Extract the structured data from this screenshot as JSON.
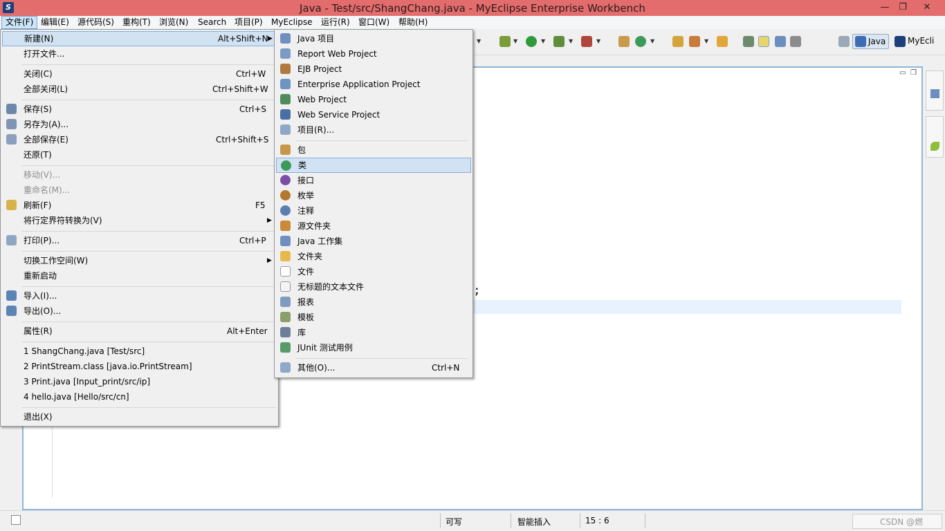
{
  "window": {
    "title": "Java  -  Test/src/ShangChang.java  -  MyEclipse Enterprise Workbench",
    "app_icon": "S",
    "min_glyph": "—",
    "max_glyph": "❐",
    "close_glyph": "✕"
  },
  "menubar": {
    "items": [
      "文件(F)",
      "编辑(E)",
      "源代码(S)",
      "重构(T)",
      "浏览(N)",
      "Search",
      "项目(P)",
      "MyEclipse",
      "运行(R)",
      "窗口(W)",
      "帮助(H)"
    ]
  },
  "toolbar": {
    "perspectives": [
      "Java",
      "MyEcli"
    ]
  },
  "editor": {
    "visible_code": ");"
  },
  "statusbar": {
    "writable": "可写",
    "insert_mode": "智能插入",
    "position": "15 : 6",
    "watermark": "CSDN @燃"
  },
  "file_menu": {
    "items": [
      {
        "label": "新建(N)",
        "shortcut": "Alt+Shift+N",
        "submenu": true
      },
      {
        "label": "打开文件..."
      },
      {
        "label": "关闭(C)",
        "shortcut": "Ctrl+W"
      },
      {
        "label": "全部关闭(L)",
        "shortcut": "Ctrl+Shift+W"
      },
      {
        "label": "保存(S)",
        "shortcut": "Ctrl+S"
      },
      {
        "label": "另存为(A)..."
      },
      {
        "label": "全部保存(E)",
        "shortcut": "Ctrl+Shift+S"
      },
      {
        "label": "还原(T)"
      },
      {
        "label": "移动(V)...",
        "disabled": true
      },
      {
        "label": "重命名(M)...",
        "disabled": true
      },
      {
        "label": "刷新(F)",
        "shortcut": "F5"
      },
      {
        "label": "将行定界符转换为(V)",
        "submenu": true
      },
      {
        "label": "打印(P)...",
        "shortcut": "Ctrl+P"
      },
      {
        "label": "切换工作空间(W)",
        "submenu": true
      },
      {
        "label": "重新启动"
      },
      {
        "label": "导入(I)..."
      },
      {
        "label": "导出(O)..."
      },
      {
        "label": "属性(R)",
        "shortcut": "Alt+Enter"
      },
      {
        "label": "1 ShangChang.java  [Test/src]"
      },
      {
        "label": "2 PrintStream.class  [java.io.PrintStream]"
      },
      {
        "label": "3 Print.java  [Input_print/src/ip]"
      },
      {
        "label": "4 hello.java  [Hello/src/cn]"
      },
      {
        "label": "退出(X)"
      }
    ]
  },
  "new_submenu": {
    "items": [
      {
        "label": "Java 项目"
      },
      {
        "label": "Report Web Project"
      },
      {
        "label": "EJB Project"
      },
      {
        "label": "Enterprise Application Project"
      },
      {
        "label": "Web Project"
      },
      {
        "label": "Web Service Project"
      },
      {
        "label": "项目(R)..."
      },
      {
        "label": "包"
      },
      {
        "label": "类"
      },
      {
        "label": "接口"
      },
      {
        "label": "枚举"
      },
      {
        "label": "注释"
      },
      {
        "label": "源文件夹"
      },
      {
        "label": "Java 工作集"
      },
      {
        "label": "文件夹"
      },
      {
        "label": "文件"
      },
      {
        "label": "无标题的文本文件"
      },
      {
        "label": "报表"
      },
      {
        "label": "模板"
      },
      {
        "label": "库"
      },
      {
        "label": "JUnit 测试用例"
      },
      {
        "label": "其他(O)...",
        "shortcut": "Ctrl+N"
      }
    ]
  },
  "colors": {
    "titlebar": "#e36c6c",
    "menu_highlight": "#d1e2f2",
    "editor_border": "#8fb6d9"
  }
}
